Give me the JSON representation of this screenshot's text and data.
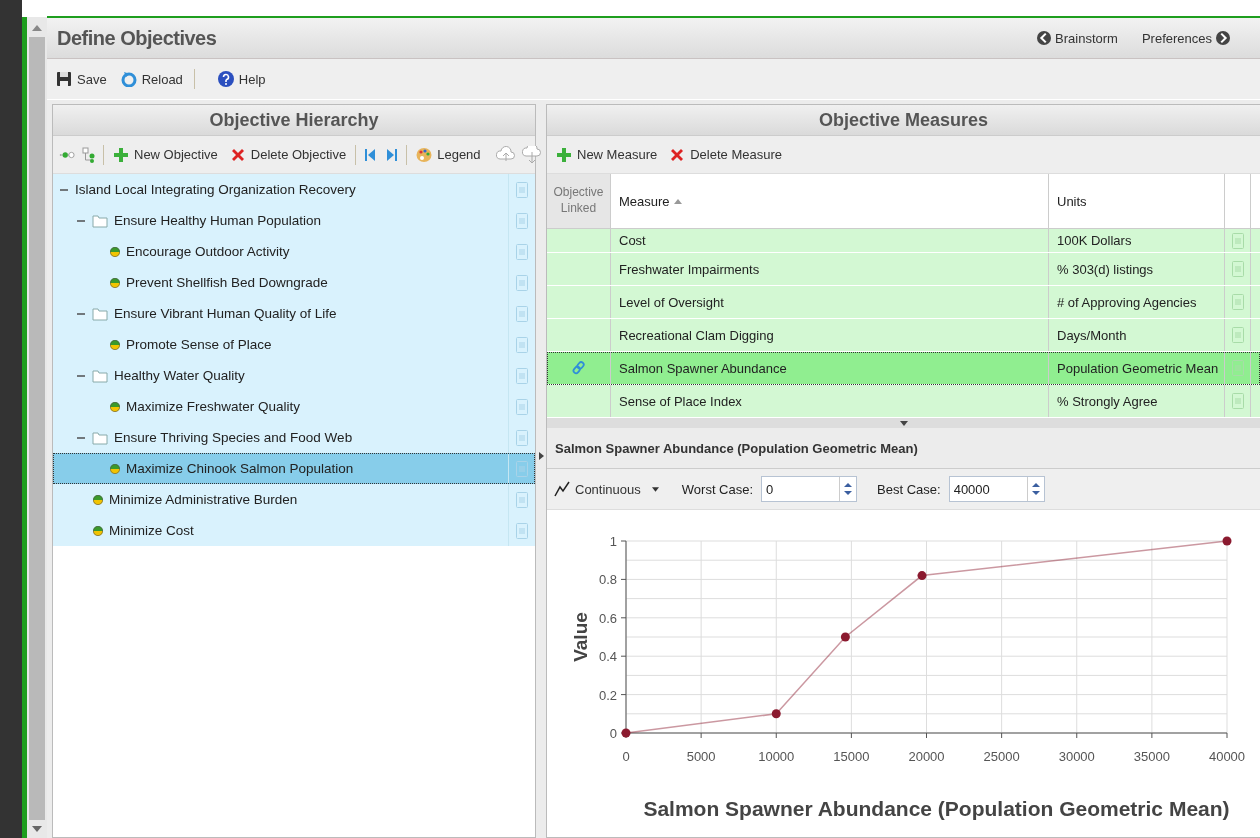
{
  "page": {
    "title": "Define Objectives",
    "nav": [
      {
        "label": "Brainstorm",
        "kind": "back"
      },
      {
        "label": "Preferences",
        "kind": "forward"
      }
    ]
  },
  "toolbar": [
    {
      "label": "Save",
      "kind": "save"
    },
    {
      "label": "Reload",
      "kind": "reload"
    },
    {
      "label": "Help",
      "kind": "help"
    }
  ],
  "hierarchy": {
    "title": "Objective Hierarchy",
    "toolbar": [
      {
        "label": "New Objective",
        "kind": "add"
      },
      {
        "label": "Delete Objective",
        "kind": "delete"
      },
      {
        "label": "Legend",
        "kind": "legend"
      }
    ],
    "tree": [
      {
        "label": "Island Local Integrating Organization Recovery",
        "kind": "root",
        "expanded": true,
        "selected": false,
        "children": [
          {
            "label": "Ensure Healthy Human Population",
            "kind": "folder",
            "expanded": true,
            "selected": false,
            "children": [
              {
                "label": "Encourage Outdoor Activity",
                "kind": "objective",
                "selected": false
              },
              {
                "label": "Prevent Shellfish Bed Downgrade",
                "kind": "objective",
                "selected": false
              }
            ]
          },
          {
            "label": "Ensure Vibrant Human Quality of Life",
            "kind": "folder",
            "expanded": true,
            "selected": false,
            "children": [
              {
                "label": "Promote Sense of Place",
                "kind": "objective",
                "selected": false
              }
            ]
          },
          {
            "label": "Healthy Water Quality",
            "kind": "folder",
            "expanded": true,
            "selected": false,
            "children": [
              {
                "label": "Maximize Freshwater Quality",
                "kind": "objective",
                "selected": false
              }
            ]
          },
          {
            "label": "Ensure Thriving Species and Food Web",
            "kind": "folder",
            "expanded": true,
            "selected": false,
            "children": [
              {
                "label": "Maximize Chinook Salmon Population",
                "kind": "objective",
                "selected": true
              }
            ]
          },
          {
            "label": "Minimize Administrative Burden",
            "kind": "objective",
            "selected": false
          },
          {
            "label": "Minimize Cost",
            "kind": "objective",
            "selected": false
          }
        ]
      }
    ]
  },
  "measures": {
    "title": "Objective Measures",
    "toolbar": [
      {
        "label": "New Measure",
        "kind": "add"
      },
      {
        "label": "Delete Measure",
        "kind": "delete"
      }
    ],
    "columns": [
      "Objective Linked",
      "Measure",
      "Units"
    ],
    "rows": [
      {
        "measure": "Cost",
        "units": "100K Dollars",
        "linked": false,
        "selected": false
      },
      {
        "measure": "Freshwater Impairments",
        "units": "% 303(d) listings",
        "linked": false,
        "selected": false
      },
      {
        "measure": "Level of Oversight",
        "units": "# of Approving Agencies",
        "linked": false,
        "selected": false
      },
      {
        "measure": "Recreational Clam Digging",
        "units": "Days/Month",
        "linked": false,
        "selected": false
      },
      {
        "measure": "Salmon Spawner Abundance",
        "units": "Population Geometric Mean",
        "linked": true,
        "selected": true
      },
      {
        "measure": "Sense of Place Index",
        "units": "% Strongly Agree",
        "linked": false,
        "selected": false
      }
    ]
  },
  "detail": {
    "title": "Salmon Spawner Abundance (Population Geometric Mean)",
    "function_type": "Continuous",
    "worst_label": "Worst Case:",
    "worst_value": "0",
    "best_label": "Best Case:",
    "best_value": "40000",
    "chart_data": {
      "type": "line",
      "xlabel": "Salmon Spawner Abundance (Population Geometric Mean)",
      "ylabel": "Value",
      "x": [
        0,
        10000,
        14600,
        19700,
        40000
      ],
      "series": [
        {
          "color": "#8b1a2f",
          "marker": "circle",
          "values": [
            0,
            0.1,
            0.5,
            0.82,
            1
          ]
        }
      ],
      "grid": true,
      "xlim": [
        0,
        40000
      ],
      "ylim": [
        0,
        1
      ],
      "xticks": [
        0,
        5000,
        10000,
        15000,
        20000,
        25000,
        30000,
        35000,
        40000
      ],
      "yticks": [
        0,
        0.2,
        0.4,
        0.6,
        0.8,
        1
      ]
    }
  }
}
